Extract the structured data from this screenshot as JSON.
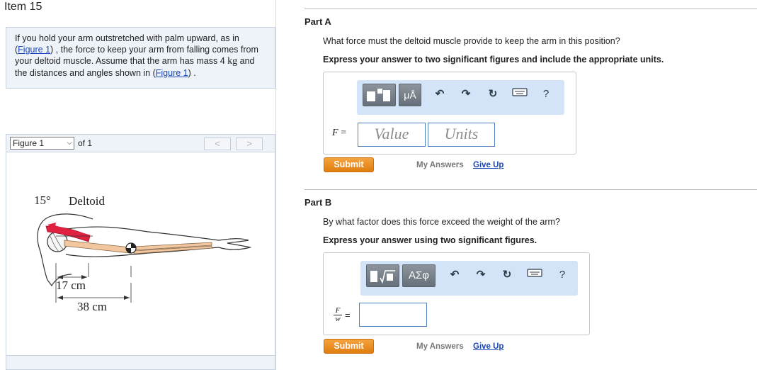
{
  "item": {
    "title": "Item 15"
  },
  "problem": {
    "text_1": "If you hold your arm outstretched with palm upward, as in (",
    "figure_link_1": "Figure 1",
    "text_2": ") , the force to keep your arm from falling comes from your deltoid muscle. Assume that the arm has mass 4 ",
    "unit": "kg",
    "text_3": " and the distances and angles shown in (",
    "figure_link_2": "Figure 1",
    "text_4": ") ."
  },
  "figure_nav": {
    "selected": "Figure 1",
    "of_label": "of 1",
    "prev_label": "<",
    "next_label": ">"
  },
  "figure": {
    "angle_label": "15°",
    "muscle_label": "Deltoid",
    "dist_1_label": "17 cm",
    "dist_2_label": "38 cm"
  },
  "part_a": {
    "title": "Part A",
    "question": "What force must the deltoid muscle provide to keep the arm in this position?",
    "instruction": "Express your answer to two significant figures and include the appropriate units.",
    "variable": "F",
    "equals": "=",
    "value_placeholder": "Value",
    "units_placeholder": "Units",
    "toolbar_unit_btn": "μÅ",
    "help": "?",
    "submit_label": "Submit",
    "my_answers_label": "My Answers",
    "give_up_label": "Give Up"
  },
  "part_b": {
    "title": "Part B",
    "question": "By what factor does this force exceed the weight of the arm?",
    "instruction": "Express your answer using two significant figures.",
    "frac_num": "F",
    "frac_den": "w",
    "equals": "=",
    "toolbar_greek_btn": "ΑΣφ",
    "help": "?",
    "submit_label": "Submit",
    "my_answers_label": "My Answers",
    "give_up_label": "Give Up"
  },
  "icons": {
    "undo": "undo-icon",
    "redo": "redo-icon",
    "reset": "reset-icon",
    "keyboard": "keyboard-icon",
    "help": "help-icon"
  },
  "colors": {
    "accent_orange": "#e8870f",
    "toolbar_blue": "#d3e4f9",
    "link_blue": "#1a47b8",
    "muscle_red": "#e0213f",
    "bone_tan": "#f2c69e"
  }
}
